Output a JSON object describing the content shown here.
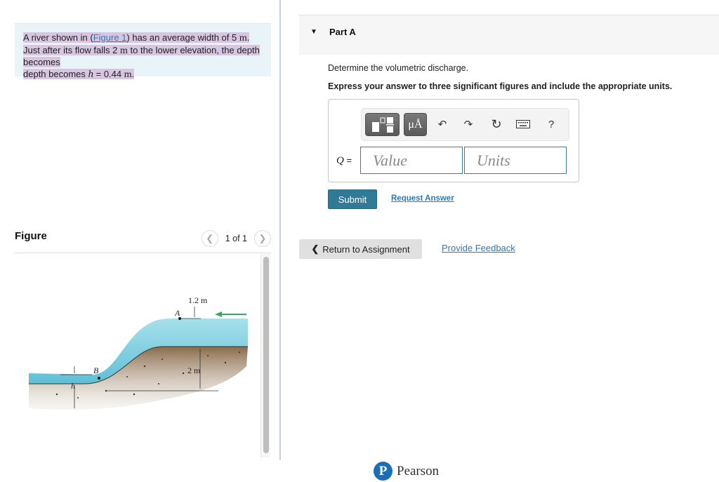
{
  "problem": {
    "text_before_link": "A river shown in (",
    "link_text": "Figure 1",
    "text_after_link": ") has an average width of 5 ",
    "unit_m": "m",
    "line2_a": ". Just after its flow falls 2 ",
    "line2_b": " to the lower elevation, the depth becomes ",
    "var_h": "h",
    "eq_value": " = 0.44 ",
    "period": "."
  },
  "figure": {
    "title": "Figure",
    "pager_text": "1 of 1",
    "prev_icon": "chevron-left-icon",
    "next_icon": "chevron-right-icon",
    "labels": {
      "top_depth": "1.2 m",
      "point_a": "A",
      "point_b": "B",
      "drop": "2 m",
      "depth_h": "h"
    },
    "colors": {
      "water": "#7fcfe0",
      "soil": "#a08468",
      "arrow": "#3aa56b"
    }
  },
  "part": {
    "title": "Part A",
    "question": "Determine the volumetric discharge.",
    "instruction": "Express your answer to three significant figures and include the appropriate units.",
    "toolbar": {
      "templates_icon": "templates-icon",
      "units_label": "μÅ",
      "undo_icon": "undo-icon",
      "redo_icon": "redo-icon",
      "reset_icon": "reset-icon",
      "keyboard_icon": "keyboard-icon",
      "help_label": "?"
    },
    "answer_label_var": "Q",
    "answer_label_eq": " =",
    "value_placeholder": "Value",
    "units_placeholder": "Units",
    "submit_label": "Submit",
    "request_answer_label": "Request Answer"
  },
  "nav": {
    "return_label": "Return to Assignment",
    "feedback_label": "Provide Feedback"
  },
  "footer": {
    "brand": "Pearson",
    "logo_letter": "P"
  },
  "colors": {
    "accent": "#2f7a96",
    "link": "#2d7ab5",
    "problem_bg": "#e9f4f8",
    "highlight": "#d8c5df"
  }
}
